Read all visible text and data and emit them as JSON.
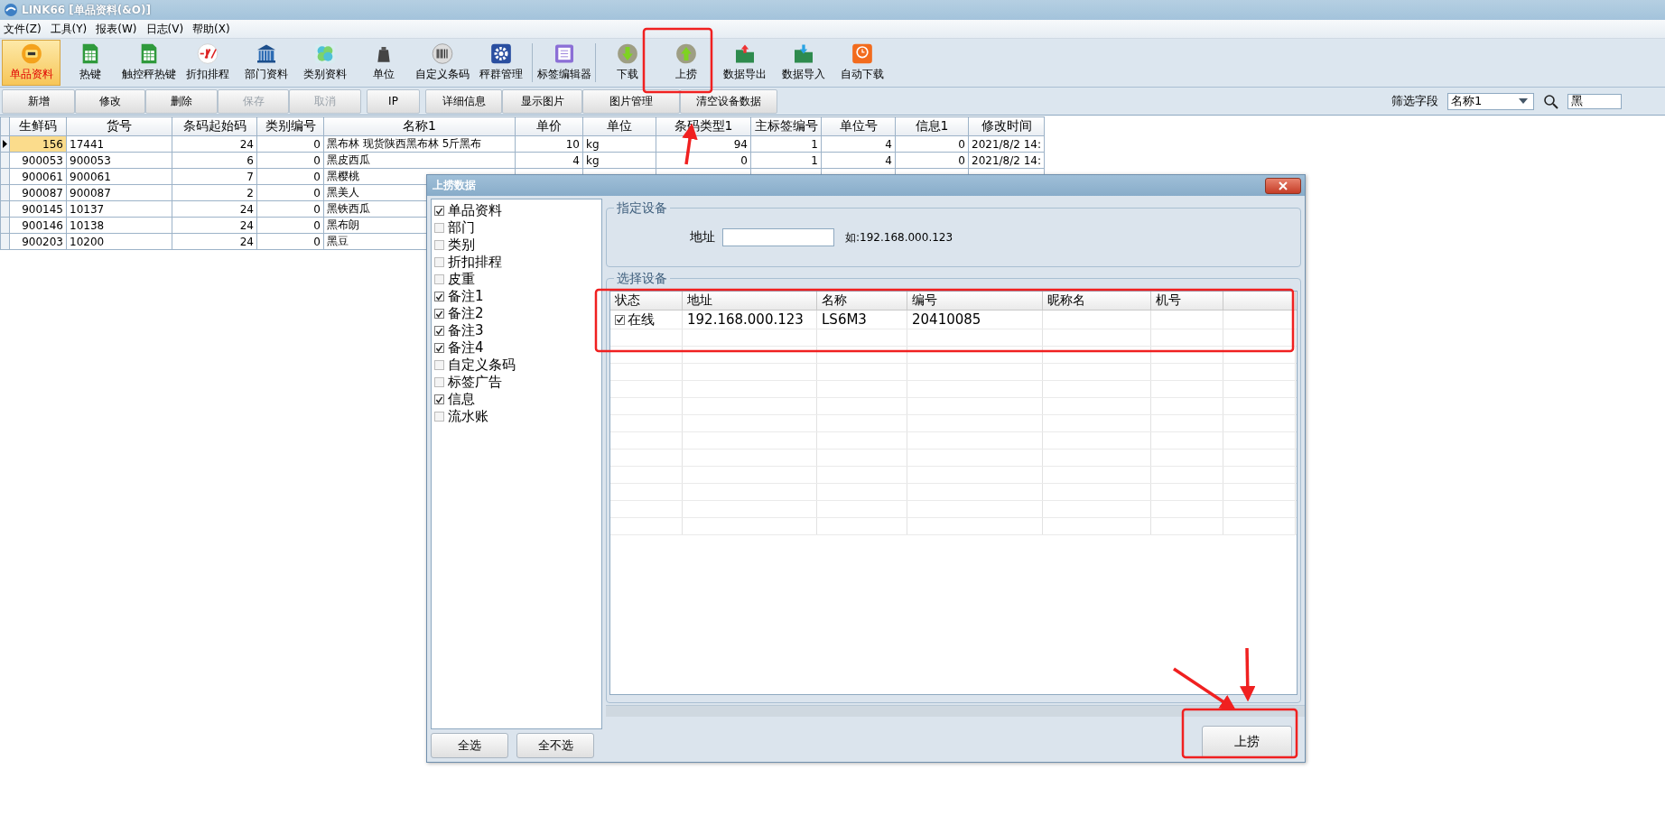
{
  "window": {
    "title": "LINK66 [单品资料(&O)]"
  },
  "menu": [
    "文件(Z)",
    "工具(Y)",
    "报表(W)",
    "日志(V)",
    "帮助(X)"
  ],
  "toolbar": [
    {
      "label": "单品资料",
      "selected": true
    },
    {
      "label": "热键",
      "selected": false
    },
    {
      "label": "触控秤热键",
      "selected": false
    },
    {
      "label": "折扣排程",
      "selected": false
    },
    {
      "label": "部门资料",
      "selected": false
    },
    {
      "label": "类别资料",
      "selected": false
    },
    {
      "label": "单位",
      "selected": false
    },
    {
      "label": "自定义条码",
      "selected": false
    },
    {
      "label": "秤群管理",
      "selected": false
    },
    {
      "label": "标签编辑器",
      "selected": false
    },
    {
      "label": "下载",
      "selected": false
    },
    {
      "label": "上捞",
      "selected": false
    },
    {
      "label": "数据导出",
      "selected": false
    },
    {
      "label": "数据导入",
      "selected": false
    },
    {
      "label": "自动下载",
      "selected": false
    }
  ],
  "actions": [
    {
      "label": "新增",
      "disabled": false
    },
    {
      "label": "修改",
      "disabled": false
    },
    {
      "label": "删除",
      "disabled": false
    },
    {
      "label": "保存",
      "disabled": true
    },
    {
      "label": "取消",
      "disabled": true
    },
    {
      "label": "IP",
      "disabled": false
    },
    {
      "label": "详细信息",
      "disabled": false
    },
    {
      "label": "显示图片",
      "disabled": false
    },
    {
      "label": "图片管理",
      "disabled": false
    },
    {
      "label": "清空设备数据",
      "disabled": false
    }
  ],
  "filter": {
    "label": "筛选字段",
    "field": "名称1",
    "search": "黑"
  },
  "table": {
    "columns": [
      "生鲜码",
      "货号",
      "条码起始码",
      "类别编号",
      "名称1",
      "单价",
      "单位",
      "条码类型1",
      "主标签编号",
      "单位号",
      "信息1",
      "修改时间"
    ],
    "rows": [
      {
        "selected": true,
        "cells": [
          "156",
          "17441",
          "24",
          "0",
          "黑布林 现货陕西黑布林 5斤黑布",
          "10",
          "kg",
          "94",
          "1",
          "4",
          "0",
          "2021/8/2 14:"
        ]
      },
      {
        "selected": false,
        "cells": [
          "900053",
          "900053",
          "6",
          "0",
          "黑皮西瓜",
          "4",
          "kg",
          "0",
          "1",
          "4",
          "0",
          "2021/8/2 14:"
        ]
      },
      {
        "selected": false,
        "cells": [
          "900061",
          "900061",
          "7",
          "0",
          "黑樱桃"
        ]
      },
      {
        "selected": false,
        "cells": [
          "900087",
          "900087",
          "2",
          "0",
          "黑美人"
        ]
      },
      {
        "selected": false,
        "cells": [
          "900145",
          "10137",
          "24",
          "0",
          "黑铁西瓜"
        ]
      },
      {
        "selected": false,
        "cells": [
          "900146",
          "10138",
          "24",
          "0",
          "黑布朗"
        ]
      },
      {
        "selected": false,
        "cells": [
          "900203",
          "10200",
          "24",
          "0",
          "黑豆"
        ]
      }
    ]
  },
  "dialog": {
    "title": "上捞数据",
    "items": [
      {
        "label": "单品资料",
        "checked": true
      },
      {
        "label": "部门",
        "checked": false
      },
      {
        "label": "类别",
        "checked": false
      },
      {
        "label": "折扣排程",
        "checked": false
      },
      {
        "label": "皮重",
        "checked": false
      },
      {
        "label": "备注1",
        "checked": true
      },
      {
        "label": "备注2",
        "checked": true
      },
      {
        "label": "备注3",
        "checked": true
      },
      {
        "label": "备注4",
        "checked": true
      },
      {
        "label": "自定义条码",
        "checked": false
      },
      {
        "label": "标签广告",
        "checked": false
      },
      {
        "label": "信息",
        "checked": true
      },
      {
        "label": "流水账",
        "checked": false
      }
    ],
    "buttons": [
      "全选",
      "全不选"
    ],
    "address_group": {
      "title": "指定设备",
      "label": "地址",
      "hint": "如:192.168.000.123"
    },
    "device_group": {
      "title": "选择设备",
      "columns": [
        "状态",
        "地址",
        "名称",
        "编号",
        "昵称名",
        "机号"
      ],
      "rows": [
        {
          "checked": true,
          "cells": [
            "在线",
            "192.168.000.123",
            "LS6M3",
            "20410085"
          ]
        }
      ]
    },
    "submit": "上捞"
  }
}
